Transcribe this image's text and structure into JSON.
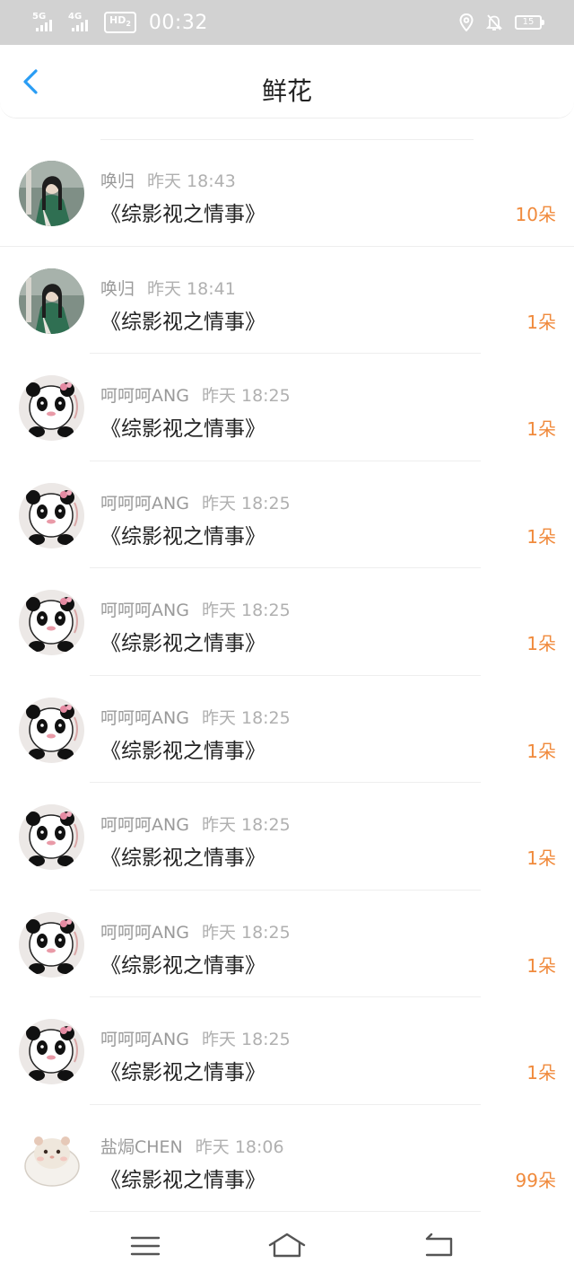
{
  "status_bar": {
    "network1": "5G",
    "network2": "4G",
    "hd_badge": "HD",
    "hd_sub": "2",
    "time": "00:32",
    "battery": "15"
  },
  "header": {
    "title": "鲜花"
  },
  "items": [
    {
      "user": "唤归",
      "time": "昨天 18:43",
      "book": "《综影视之情事》",
      "count": "10朵",
      "avatar": "portrait"
    },
    {
      "user": "唤归",
      "time": "昨天 18:41",
      "book": "《综影视之情事》",
      "count": "1朵",
      "avatar": "portrait"
    },
    {
      "user": "呵呵呵ANG",
      "time": "昨天 18:25",
      "book": "《综影视之情事》",
      "count": "1朵",
      "avatar": "panda"
    },
    {
      "user": "呵呵呵ANG",
      "time": "昨天 18:25",
      "book": "《综影视之情事》",
      "count": "1朵",
      "avatar": "panda"
    },
    {
      "user": "呵呵呵ANG",
      "time": "昨天 18:25",
      "book": "《综影视之情事》",
      "count": "1朵",
      "avatar": "panda"
    },
    {
      "user": "呵呵呵ANG",
      "time": "昨天 18:25",
      "book": "《综影视之情事》",
      "count": "1朵",
      "avatar": "panda"
    },
    {
      "user": "呵呵呵ANG",
      "time": "昨天 18:25",
      "book": "《综影视之情事》",
      "count": "1朵",
      "avatar": "panda"
    },
    {
      "user": "呵呵呵ANG",
      "time": "昨天 18:25",
      "book": "《综影视之情事》",
      "count": "1朵",
      "avatar": "panda"
    },
    {
      "user": "呵呵呵ANG",
      "time": "昨天 18:25",
      "book": "《综影视之情事》",
      "count": "1朵",
      "avatar": "panda"
    },
    {
      "user": "盐焗CHEN",
      "time": "昨天 18:06",
      "book": "《综影视之情事》",
      "count": "99朵",
      "avatar": "hamster"
    }
  ],
  "colors": {
    "accent_blue": "#2a9df4",
    "count_orange": "#f08a3c",
    "status_bar_bg": "#d2d2d2"
  },
  "icons": {
    "back": "chevron-left-icon",
    "menu": "menu-icon",
    "home": "home-icon",
    "return": "return-icon"
  }
}
